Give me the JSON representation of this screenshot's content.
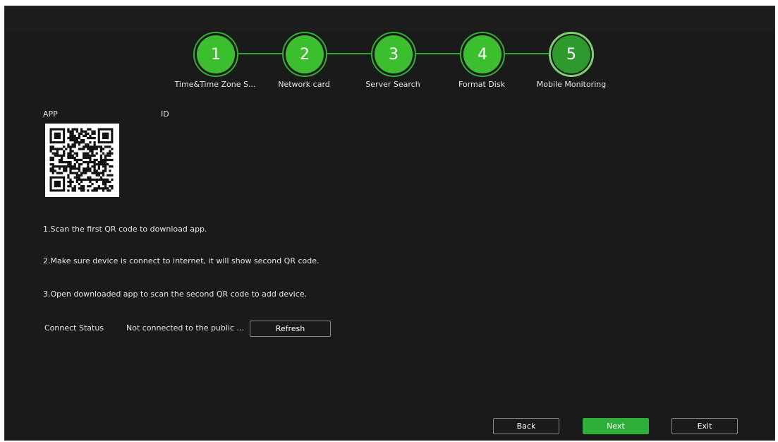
{
  "wizard": {
    "steps": [
      {
        "number": "1",
        "label": "Time&Time Zone S..."
      },
      {
        "number": "2",
        "label": "Network card"
      },
      {
        "number": "3",
        "label": "Server Search"
      },
      {
        "number": "4",
        "label": "Format Disk"
      },
      {
        "number": "5",
        "label": "Mobile Monitoring"
      }
    ],
    "active_step": 5
  },
  "mobile": {
    "app_label": "APP",
    "id_label": "ID",
    "qr_icon": "qr-code-icon",
    "instructions": [
      "1.Scan the first QR code to download app.",
      "2.Make sure device is connect to internet, it will show second QR code.",
      "3.Open downloaded app to scan the second QR code to add device."
    ],
    "connect_status_label": "Connect Status",
    "connect_status_value": "Not connected to the public ...",
    "refresh_label": "Refresh"
  },
  "footer": {
    "back_label": "Back",
    "next_label": "Next",
    "exit_label": "Exit"
  },
  "colors": {
    "background": "#1a1a1a",
    "accent_green": "#3cbf2e",
    "active_step_green": "#2e9a2e",
    "primary_button": "#2fae3a",
    "text": "#e6e6e6"
  }
}
